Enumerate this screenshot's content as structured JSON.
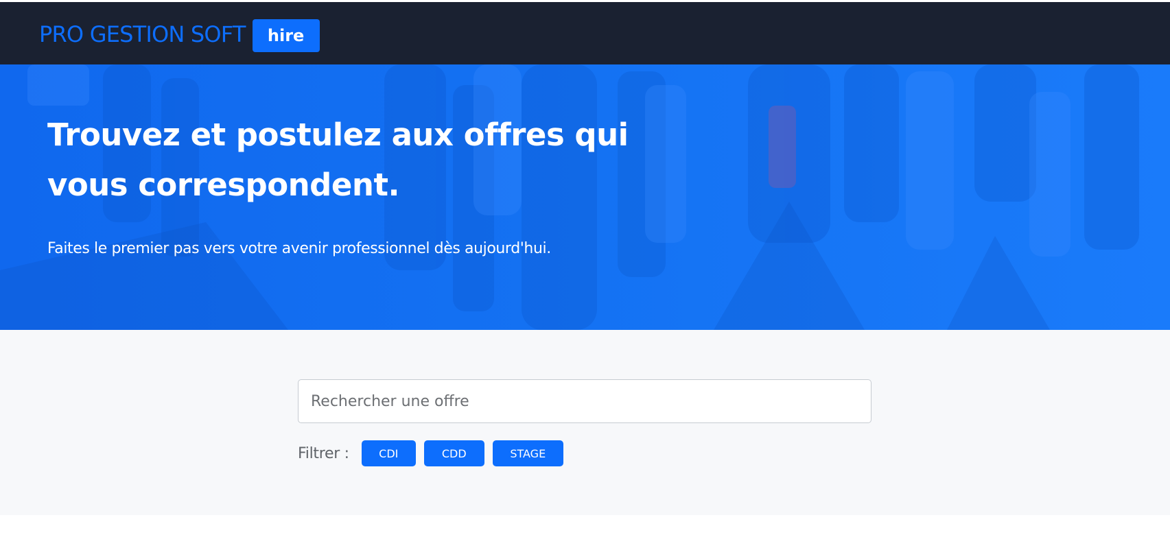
{
  "navbar": {
    "brand_name": "PRO GESTION SOFT",
    "brand_badge": "hire"
  },
  "hero": {
    "title": "Trouvez et postulez aux offres qui vous correspondent.",
    "subtitle": "Faites le premier pas vers votre avenir professionnel dès aujourd'hui."
  },
  "search": {
    "placeholder": "Rechercher une offre",
    "value": "",
    "filter_label": "Filtrer :",
    "filters": [
      {
        "label": "CDI"
      },
      {
        "label": "CDD"
      },
      {
        "label": "STAGE"
      }
    ]
  },
  "colors": {
    "navbar_bg": "#1a2131",
    "primary": "#0d6efd",
    "hero_bg": "#1774f2",
    "section_bg": "#f7f8fa"
  }
}
